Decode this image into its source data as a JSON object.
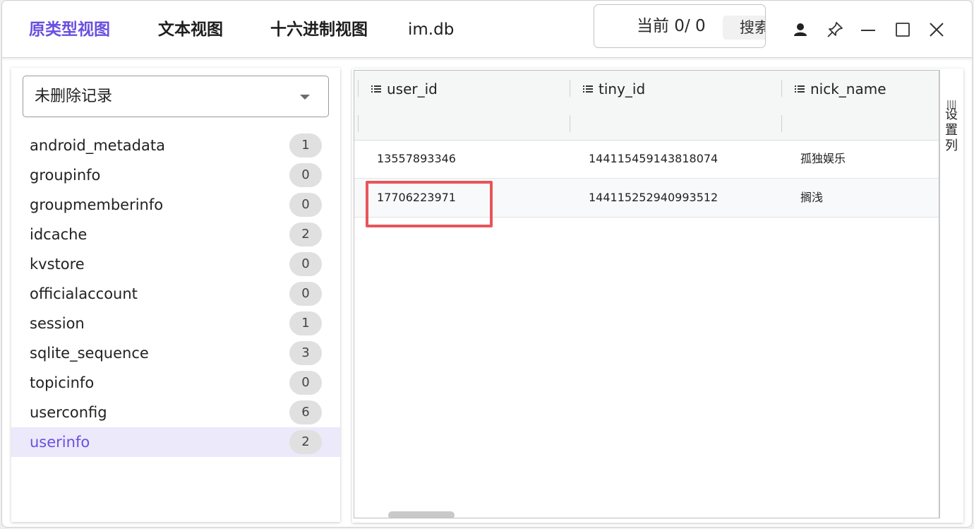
{
  "header": {
    "tabs": [
      "原类型视图",
      "文本视图",
      "十六进制视图"
    ],
    "db_name": "im.db",
    "search": {
      "status": "当前  0/  0",
      "button_label": "搜索"
    }
  },
  "sidebar": {
    "filter_value": "未删除记录",
    "tables": [
      {
        "name": "android_metadata",
        "count": "1"
      },
      {
        "name": "groupinfo",
        "count": "0"
      },
      {
        "name": "groupmemberinfo",
        "count": "0"
      },
      {
        "name": "idcache",
        "count": "2"
      },
      {
        "name": "kvstore",
        "count": "0"
      },
      {
        "name": "officialaccount",
        "count": "0"
      },
      {
        "name": "session",
        "count": "1"
      },
      {
        "name": "sqlite_sequence",
        "count": "3"
      },
      {
        "name": "topicinfo",
        "count": "0"
      },
      {
        "name": "userconfig",
        "count": "6"
      },
      {
        "name": "userinfo",
        "count": "2"
      }
    ],
    "selected_index": 10
  },
  "grid": {
    "columns": [
      "user_id",
      "tiny_id",
      "nick_name"
    ],
    "rows": [
      [
        "13557893346",
        "144115459143818074",
        "孤独娱乐"
      ],
      [
        "17706223971",
        "144115252940993512",
        "搁浅"
      ]
    ],
    "side_panel_label": "设置列"
  },
  "colors": {
    "accent": "#6a4fe0",
    "selected_bg": "#ece9fb",
    "highlight_border": "#e8555a",
    "badge_bg": "#e0e0e0"
  }
}
